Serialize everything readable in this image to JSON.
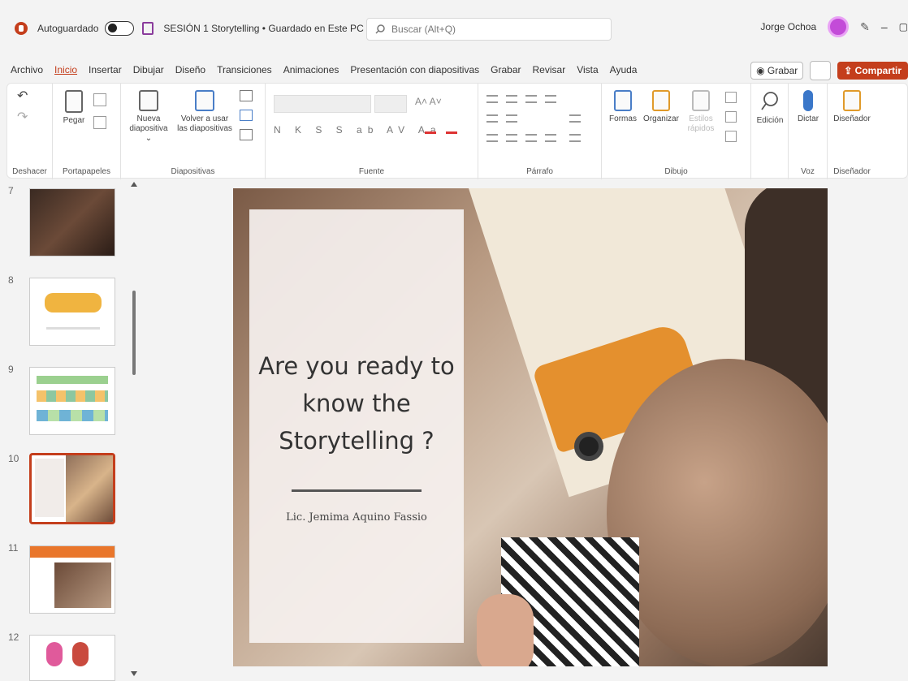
{
  "titlebar": {
    "autosave_label": "Autoguardado",
    "doc_title": "SESIÓN 1 Storytelling • Guardado en Este PC ⌄",
    "search_placeholder": "Buscar (Alt+Q)",
    "user_name": "Jorge Ochoa",
    "minimize": "–",
    "restore": "▢"
  },
  "menu": {
    "items": [
      "Archivo",
      "Inicio",
      "Insertar",
      "Dibujar",
      "Diseño",
      "Transiciones",
      "Animaciones",
      "Presentación con diapositivas",
      "Grabar",
      "Revisar",
      "Vista",
      "Ayuda"
    ],
    "record_label": "◉ Grabar",
    "share_label": "⇪ Compartir"
  },
  "ribbon": {
    "undo_group": "Deshacer",
    "clipboard_group": "Portapapeles",
    "paste": "Pegar",
    "slides_group": "Diapositivas",
    "new_slide": "Nueva diapositiva ⌄",
    "reuse_slides": "Volver a usar las diapositivas",
    "font_group": "Fuente",
    "font_row": "N K S S ab AV Aa",
    "paragraph_group": "Párrafo",
    "drawing_group": "Dibujo",
    "shapes": "Formas",
    "arrange": "Organizar",
    "quick_styles": "Estilos rápidos",
    "voice_group": "Voz",
    "edit": "Edición",
    "dictate": "Dictar",
    "designer_group": "Diseñador",
    "designer": "Diseñador"
  },
  "sidebar": {
    "slides": [
      {
        "num": "7"
      },
      {
        "num": "8"
      },
      {
        "num": "9"
      },
      {
        "num": "10"
      },
      {
        "num": "11"
      },
      {
        "num": "12"
      }
    ]
  },
  "slide": {
    "title": "Are you ready to know the Storytelling ?",
    "subtitle": "Lic. Jemima Aquino Fassio"
  },
  "colors": {
    "accent": "#c43e1c"
  }
}
